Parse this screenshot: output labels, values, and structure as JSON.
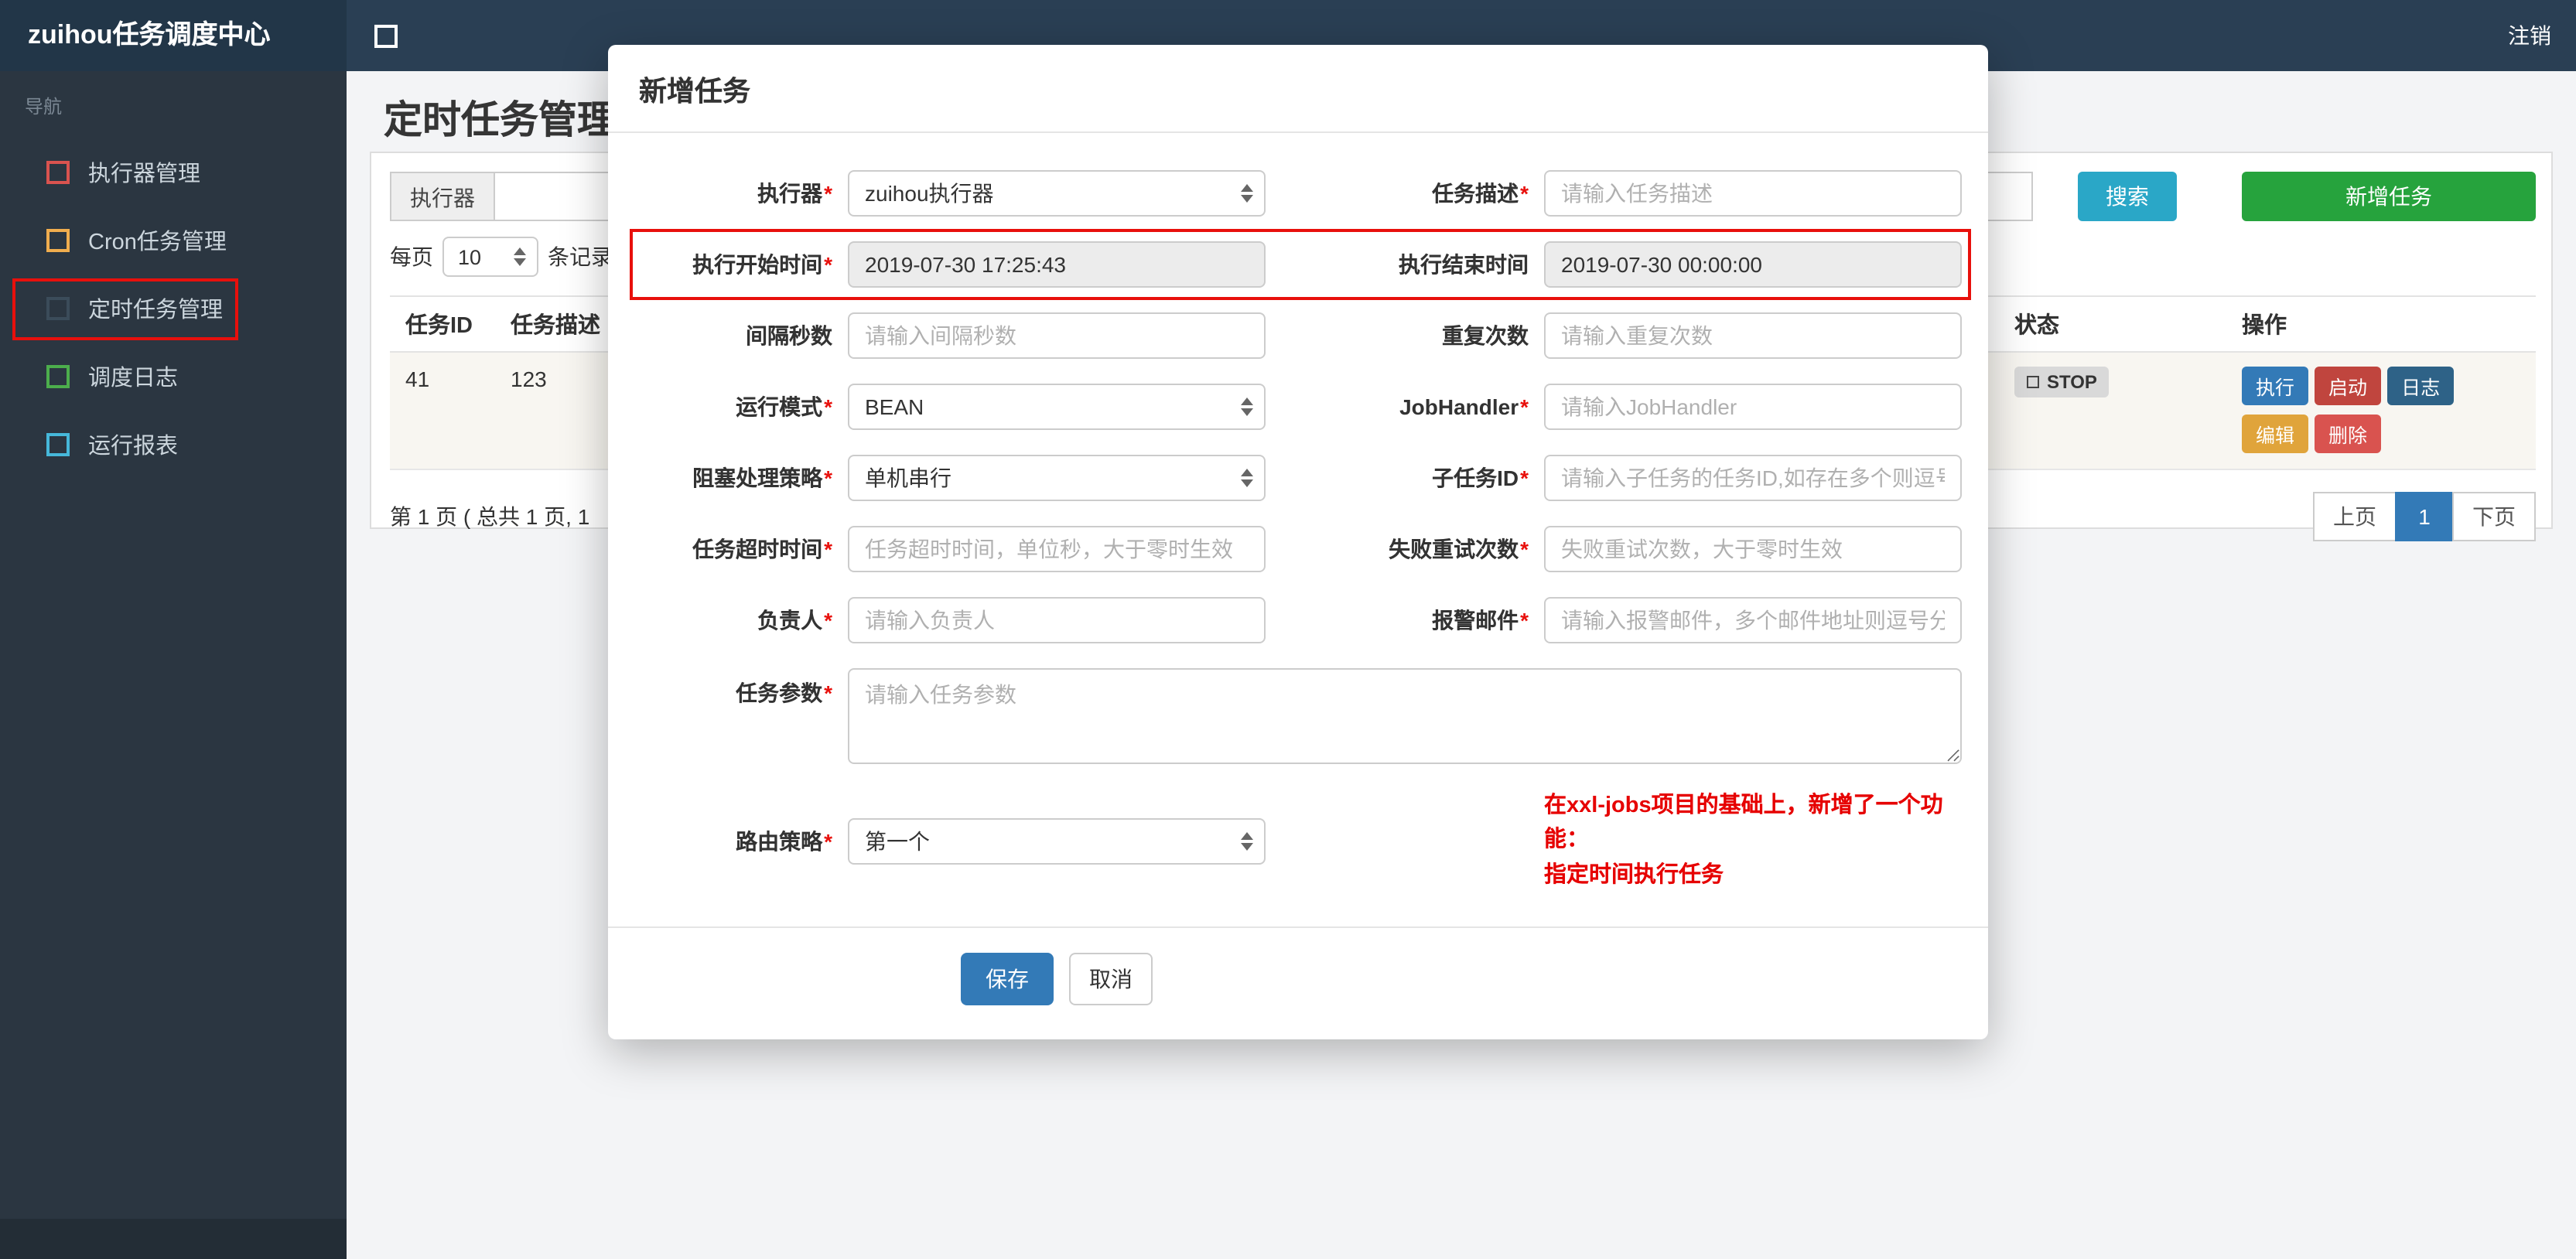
{
  "colors": {
    "annotation": "#e8100c",
    "search_btn": "#2aa7c7",
    "add_btn": "#26a33d",
    "save_btn": "#337ab7",
    "active_page_bg": "#337ab7"
  },
  "topbar": {
    "brand": "zuihou任务调度中心",
    "logout": "注销"
  },
  "sidebar": {
    "nav_label": "导航",
    "items": [
      {
        "label": "执行器管理",
        "color": "#d9534f"
      },
      {
        "label": "Cron任务管理",
        "color": "#f0ad4e"
      },
      {
        "label": "定时任务管理",
        "color": "#3b4c5a"
      },
      {
        "label": "调度日志",
        "color": "#4cae4c"
      },
      {
        "label": "运行报表",
        "color": "#46b8da"
      }
    ]
  },
  "page": {
    "title": "定时任务管理"
  },
  "filter": {
    "executor_label": "执行器",
    "search_label": "搜索",
    "add_label": "新增任务"
  },
  "perpage": {
    "prefix": "每页",
    "value": "10",
    "suffix": "条记录"
  },
  "table": {
    "headers": [
      "任务ID",
      "任务描述",
      "状态",
      "操作"
    ],
    "row": {
      "id": "41",
      "desc": "123",
      "status": "STOP"
    },
    "actions": [
      {
        "label": "执行",
        "color": "#337ab7"
      },
      {
        "label": "启动",
        "color": "#c0453e"
      },
      {
        "label": "日志",
        "color": "#2e6287"
      },
      {
        "label": "编辑",
        "color": "#e0a43b"
      },
      {
        "label": "删除",
        "color": "#d9534f"
      }
    ]
  },
  "pagination": {
    "summary": "第 1 页 ( 总共 1 页, 1",
    "prev": "上页",
    "current": "1",
    "next": "下页"
  },
  "modal": {
    "title": "新增任务",
    "required_mark": "*",
    "executor": {
      "label": "执行器",
      "value": "zuihou执行器"
    },
    "job_desc": {
      "label": "任务描述",
      "placeholder": "请输入任务描述"
    },
    "start_time": {
      "label": "执行开始时间",
      "value": "2019-07-30 17:25:43"
    },
    "end_time": {
      "label": "执行结束时间",
      "value": "2019-07-30 00:00:00"
    },
    "interval": {
      "label": "间隔秒数",
      "placeholder": "请输入间隔秒数"
    },
    "repeat_count": {
      "label": "重复次数",
      "placeholder": "请输入重复次数"
    },
    "run_mode": {
      "label": "运行模式",
      "value": "BEAN"
    },
    "job_handler": {
      "label": "JobHandler",
      "placeholder": "请输入JobHandler"
    },
    "block_strategy": {
      "label": "阻塞处理策略",
      "value": "单机串行"
    },
    "child_job_id": {
      "label": "子任务ID",
      "placeholder": "请输入子任务的任务ID,如存在多个则逗号分隔"
    },
    "timeout": {
      "label": "任务超时时间",
      "placeholder": "任务超时时间，单位秒，大于零时生效"
    },
    "fail_retry": {
      "label": "失败重试次数",
      "placeholder": "失败重试次数，大于零时生效"
    },
    "owner": {
      "label": "负责人",
      "placeholder": "请输入负责人"
    },
    "alarm_email": {
      "label": "报警邮件",
      "placeholder": "请输入报警邮件，多个邮件地址则逗号分隔"
    },
    "job_param": {
      "label": "任务参数",
      "placeholder": "请输入任务参数"
    },
    "route_strategy": {
      "label": "路由策略",
      "value": "第一个"
    },
    "note_line1": "在xxl-jobs项目的基础上，新增了一个功能：",
    "note_line2": "指定时间执行任务",
    "save_label": "保存",
    "cancel_label": "取消"
  }
}
